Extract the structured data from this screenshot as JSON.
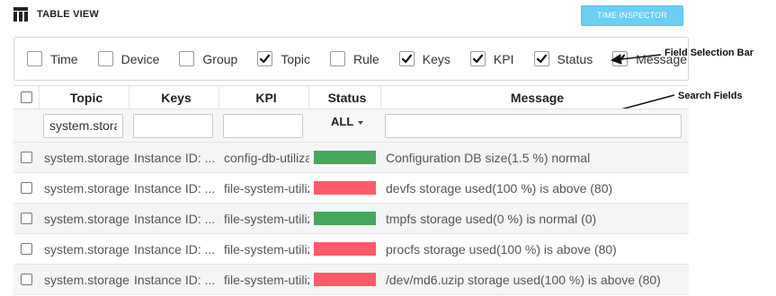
{
  "header": {
    "title": "TABLE VIEW",
    "icon": "table-icon"
  },
  "toolbar": {
    "inspector_label": "TIME INSPECTOR"
  },
  "field_bar": {
    "items": [
      {
        "label": "Time",
        "checked": false
      },
      {
        "label": "Device",
        "checked": false
      },
      {
        "label": "Group",
        "checked": false
      },
      {
        "label": "Topic",
        "checked": true
      },
      {
        "label": "Rule",
        "checked": false
      },
      {
        "label": "Keys",
        "checked": true
      },
      {
        "label": "KPI",
        "checked": true
      },
      {
        "label": "Status",
        "checked": true
      },
      {
        "label": "Message",
        "checked": true
      }
    ]
  },
  "annotations": {
    "field_bar": "Field Selection Bar",
    "search": "Search Fields"
  },
  "table": {
    "columns": [
      "Topic",
      "Keys",
      "KPI",
      "Status",
      "Message"
    ],
    "search": {
      "topic_value": "system.storage",
      "status_filter": "ALL"
    },
    "rows": [
      {
        "topic": "system.storage",
        "keys": "Instance ID: ...",
        "kpi": "config-db-utilization",
        "status": "normal",
        "message": "Configuration DB size(1.5 %) normal"
      },
      {
        "topic": "system.storage",
        "keys": "Instance ID: ...",
        "kpi": "file-system-utilization",
        "status": "major",
        "message": "devfs storage used(100 %) is above (80)"
      },
      {
        "topic": "system.storage",
        "keys": "Instance ID: ...",
        "kpi": "file-system-utilization",
        "status": "normal",
        "message": "tmpfs storage used(0 %) is normal (0)"
      },
      {
        "topic": "system.storage",
        "keys": "Instance ID: ...",
        "kpi": "file-system-utilization",
        "status": "major",
        "message": "procfs storage used(100 %) is above (80)"
      },
      {
        "topic": "system.storage",
        "keys": "Instance ID: ...",
        "kpi": "file-system-utilization",
        "status": "major",
        "message": "/dev/md6.uzip storage used(100 %) is above (80)"
      }
    ]
  },
  "colors": {
    "normal": "#46a85a",
    "major": "#ff5a6a",
    "accent": "#6ccdf5"
  }
}
